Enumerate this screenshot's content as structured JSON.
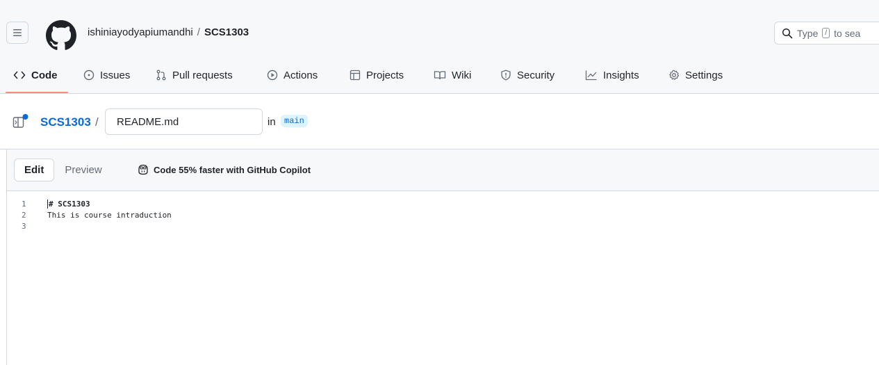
{
  "header": {
    "owner": "ishiniayodyapiumandhi",
    "separator": "/",
    "repo": "SCS1303",
    "search_text": "Type",
    "search_key": "/",
    "search_suffix": "to sea"
  },
  "tabs": [
    {
      "label": "Code",
      "icon": "code-icon"
    },
    {
      "label": "Issues",
      "icon": "issue-icon"
    },
    {
      "label": "Pull requests",
      "icon": "pull-request-icon"
    },
    {
      "label": "Actions",
      "icon": "play-icon"
    },
    {
      "label": "Projects",
      "icon": "table-icon"
    },
    {
      "label": "Wiki",
      "icon": "book-icon"
    },
    {
      "label": "Security",
      "icon": "shield-icon"
    },
    {
      "label": "Insights",
      "icon": "graph-icon"
    },
    {
      "label": "Settings",
      "icon": "gear-icon"
    }
  ],
  "breadcrumb": {
    "repo": "SCS1303",
    "slash": "/",
    "filename": "README.md",
    "in_label": "in",
    "branch": "main"
  },
  "editor": {
    "edit_label": "Edit",
    "preview_label": "Preview",
    "copilot_label": "Code 55% faster with GitHub Copilot",
    "lines": [
      {
        "num": "1",
        "text": "# SCS1303"
      },
      {
        "num": "2",
        "text": "This is course intraduction"
      },
      {
        "num": "3",
        "text": ""
      }
    ]
  },
  "colors": {
    "accent": "#0969da",
    "tab_underline": "#fd8c73",
    "header_bg": "#f6f8fa"
  }
}
